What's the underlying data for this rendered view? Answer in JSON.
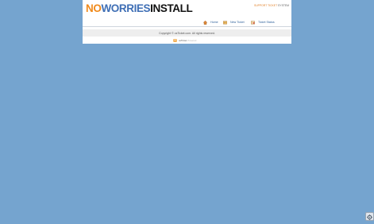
{
  "header": {
    "logo": {
      "part1": "NO",
      "part2": "WORRIES",
      "part3": "INSTALL"
    },
    "support_label": "SUPPORT TICKET",
    "system_label": "SYSTEM"
  },
  "nav": {
    "home": {
      "label": "Home",
      "icon": "home-icon"
    },
    "new_ticket": {
      "label": "New Ticket",
      "icon": "new-ticket-icon"
    },
    "ticket_status": {
      "label": "Ticket Status",
      "icon": "ticket-status-icon"
    }
  },
  "footer": {
    "copyright": "Copyright © osTicket.com. All rights reserved.",
    "powered_brand": "osTicket",
    "powered_suffix": "Powered"
  },
  "widget": {
    "icon": "settings-gear-icon"
  },
  "colors": {
    "background": "#75a4cf",
    "logo_orange": "#f08a1c",
    "logo_blue": "#3f6fb5",
    "link": "#2c5f9a"
  }
}
